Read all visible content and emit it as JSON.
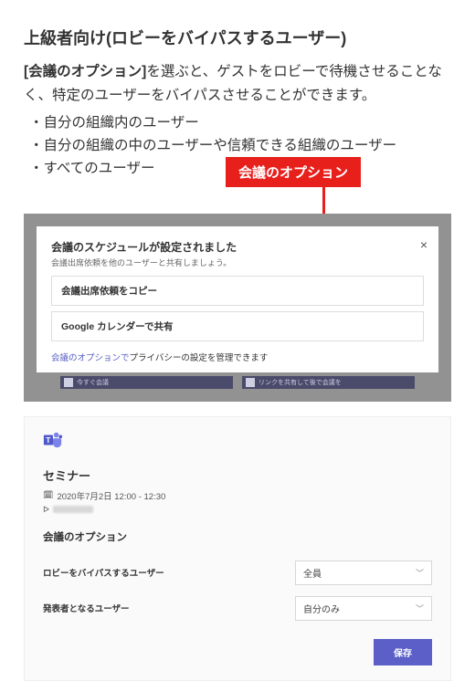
{
  "section_title": "上級者向け(ロビーをバイパスするユーザー)",
  "lead": {
    "strong": "[会議のオプション]",
    "rest": "を選ぶと、ゲストをロビーで待機させることなく、特定のユーザーをバイパスさせることができます。"
  },
  "bullets": [
    "自分の組織内のユーザー",
    "自分の組織の中のユーザーや信頼できる組織のユーザー",
    "すべてのユーザー"
  ],
  "callout_badge": "会議のオプション",
  "shot1": {
    "title": "会議のスケジュールが設定されました",
    "subtitle": "会議出席依頼を他のユーザーと共有しましょう。",
    "copy_btn": "会議出席依頼をコピー",
    "google_btn": "Google カレンダーで共有",
    "link_text": "会議のオプションで",
    "link_rest": "プライバシーの設定を管理できます",
    "close_glyph": "×",
    "task_left": "今すぐ会議",
    "task_right": "リンクを共有して後で会議を"
  },
  "shot2": {
    "meeting_title": "セミナー",
    "datetime": "2020年7月2日 12:00 - 12:30",
    "options_heading": "会議のオプション",
    "row1_label": "ロビーをバイパスするユーザー",
    "row1_value": "全員",
    "row2_label": "発表者となるユーザー",
    "row2_value": "自分のみ",
    "save": "保存"
  }
}
